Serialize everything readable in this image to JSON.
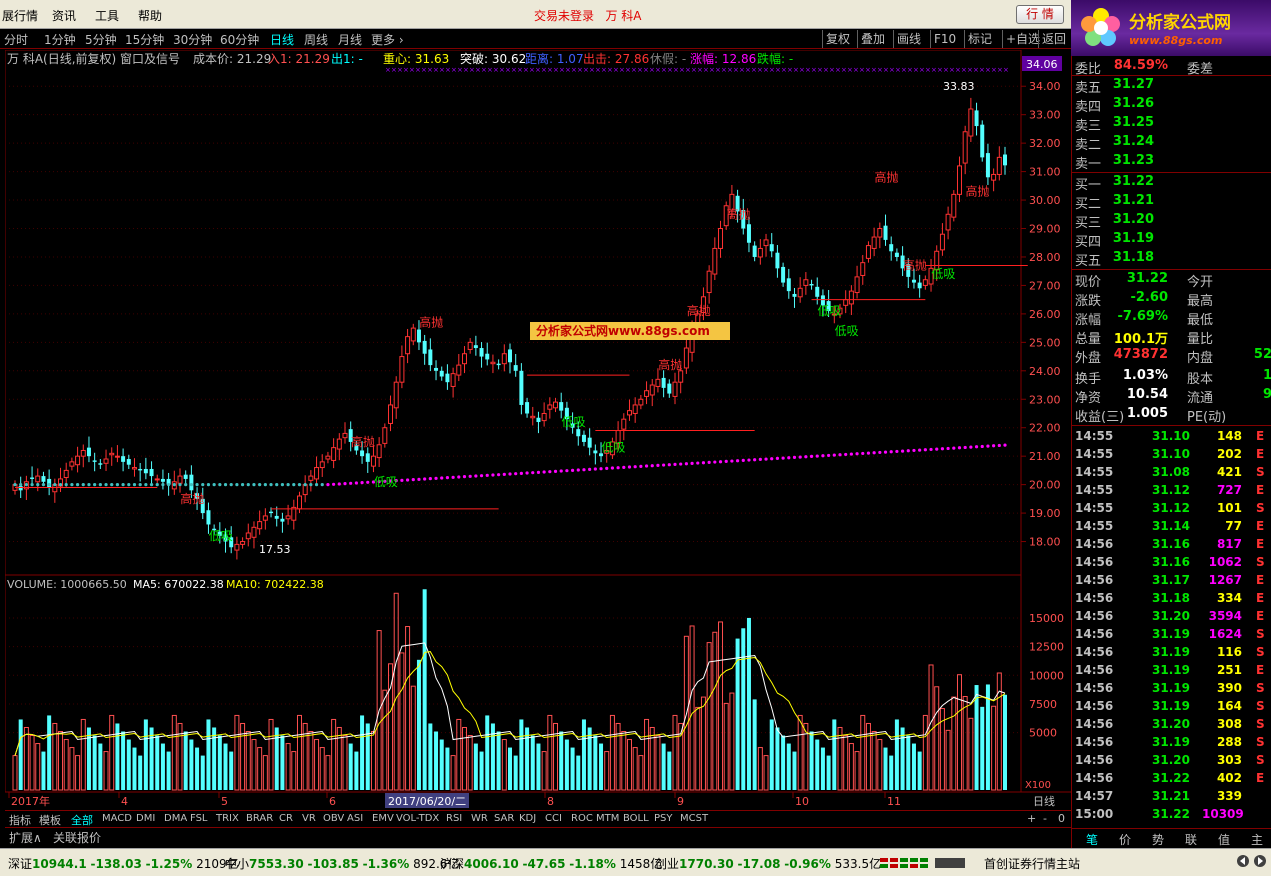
{
  "menu": [
    "展行情",
    "资讯",
    "工具",
    "帮助"
  ],
  "login_status": "交易未登录",
  "stock_name_top": "万 科A",
  "quote_button": "行 情",
  "logo": {
    "text": "分析家公式网",
    "url": "www.88gs.com"
  },
  "periods": [
    "分时",
    "1分钟",
    "5分钟",
    "15分钟",
    "30分钟",
    "60分钟",
    "日线",
    "周线",
    "月线",
    "更多 ›"
  ],
  "active_period": "日线",
  "right_buttons": [
    "复权",
    "叠加",
    "画线",
    "F10",
    "标记",
    "+自选",
    "返回"
  ],
  "info_line": {
    "title": "万 科A(日线,前复权) 窗口及信号",
    "cost": "成本价: 21.29",
    "in": "入1: 21.29",
    "out": "出1: -",
    "center": "重心: 31.63",
    "break": "突破: 30.62",
    "dist": "距离: 1.07",
    "exit": "出击: 27.86",
    "rest": "休假: -",
    "rise": "涨幅: 12.86",
    "fall": "跌幅: -"
  },
  "watermark": "分析家公式网www.88gs.com",
  "price_axis": {
    "labels": [
      "34.00",
      "33.00",
      "32.00",
      "31.00",
      "30.00",
      "29.00",
      "28.00",
      "27.00",
      "26.00",
      "25.00",
      "24.00",
      "23.00",
      "22.00",
      "21.00",
      "20.00",
      "19.00",
      "18.00"
    ],
    "current_tag": "34.06"
  },
  "volume_axis": {
    "labels": [
      "15000",
      "12500",
      "10000",
      "7500",
      "5000"
    ],
    "unit": "X100"
  },
  "volume_info": {
    "vol": "VOLUME: 1000665.50",
    "ma5": "MA5: 670022.38",
    "ma10": "MA10: 702422.38"
  },
  "date_axis": {
    "labels": [
      "2017年",
      "4",
      "5",
      "6",
      "8",
      "9",
      "10",
      "11"
    ],
    "cursor": "2017/06/20/二",
    "period": "日线"
  },
  "annotations": {
    "high": "33.83",
    "low": "17.53",
    "sell": "高抛",
    "buy": "低吸"
  },
  "chart_data": {
    "type": "candlestick",
    "ylim": [
      17,
      34.5
    ],
    "closes": [
      20.0,
      19.8,
      20.1,
      20.2,
      20.3,
      20.1,
      19.9,
      20.0,
      20.2,
      20.5,
      20.8,
      21.0,
      21.2,
      21.0,
      20.8,
      20.7,
      20.9,
      21.1,
      21.0,
      20.8,
      20.7,
      20.6,
      20.5,
      20.4,
      20.3,
      20.2,
      20.1,
      20.0,
      20.1,
      20.3,
      20.2,
      19.8,
      19.5,
      19.0,
      18.6,
      18.4,
      18.2,
      18.0,
      17.8,
      17.9,
      18.0,
      18.3,
      18.5,
      18.7,
      18.9,
      19.0,
      18.8,
      18.7,
      18.9,
      19.2,
      19.6,
      20.0,
      20.3,
      20.6,
      20.8,
      21.0,
      21.3,
      21.6,
      21.8,
      21.5,
      21.2,
      21.0,
      20.8,
      21.0,
      21.4,
      22.0,
      22.8,
      23.6,
      24.5,
      25.2,
      25.5,
      25.0,
      24.6,
      24.2,
      24.0,
      23.8,
      23.6,
      23.9,
      24.2,
      24.6,
      25.0,
      24.8,
      24.5,
      24.4,
      24.3,
      24.2,
      24.6,
      24.3,
      24.0,
      22.8,
      22.5,
      22.4,
      22.2,
      22.5,
      22.8,
      22.9,
      22.6,
      22.3,
      22.0,
      21.7,
      21.5,
      21.3,
      21.1,
      21.0,
      21.2,
      21.5,
      21.9,
      22.3,
      22.6,
      22.8,
      23.0,
      23.3,
      23.5,
      23.7,
      23.4,
      23.2,
      23.6,
      24.0,
      24.8,
      25.5,
      26.0,
      26.6,
      27.5,
      28.3,
      29.0,
      29.8,
      30.2,
      29.6,
      29.0,
      28.5,
      28.0,
      28.3,
      28.6,
      28.2,
      27.6,
      27.1,
      26.8,
      26.6,
      26.9,
      27.2,
      27.0,
      26.6,
      26.3,
      26.1,
      26.0,
      26.2,
      26.5,
      26.8,
      27.3,
      27.8,
      28.4,
      28.7,
      29.0,
      28.6,
      28.2,
      28.0,
      27.6,
      27.3,
      27.1,
      26.9,
      27.2,
      27.6,
      28.2,
      28.8,
      29.5,
      30.2,
      31.2,
      32.4,
      33.2,
      32.6,
      31.5,
      30.8,
      30.9,
      31.5,
      31.22
    ],
    "series": [
      {
        "name": "VOLUME",
        "values": [
          1000665.5
        ]
      },
      {
        "name": "MA5",
        "values": [
          670022.38
        ]
      },
      {
        "name": "MA10",
        "values": [
          702422.38
        ]
      }
    ]
  },
  "order_book": {
    "ratio_label": "委比",
    "ratio": "84.59%",
    "diff_label": "委差",
    "sells": [
      {
        "label": "卖五",
        "price": "31.27"
      },
      {
        "label": "卖四",
        "price": "31.26"
      },
      {
        "label": "卖三",
        "price": "31.25"
      },
      {
        "label": "卖二",
        "price": "31.24"
      },
      {
        "label": "卖一",
        "price": "31.23"
      }
    ],
    "buys": [
      {
        "label": "买一",
        "price": "31.22"
      },
      {
        "label": "买二",
        "price": "31.21"
      },
      {
        "label": "买三",
        "price": "31.20"
      },
      {
        "label": "买四",
        "price": "31.19"
      },
      {
        "label": "买五",
        "price": "31.18"
      }
    ]
  },
  "quote": [
    {
      "l": "现价",
      "v": "31.22",
      "vc": "green",
      "l2": "今开",
      "v2": ""
    },
    {
      "l": "涨跌",
      "v": "-2.60",
      "vc": "green",
      "l2": "最高",
      "v2": ""
    },
    {
      "l": "涨幅",
      "v": "-7.69%",
      "vc": "green",
      "l2": "最低",
      "v2": ""
    },
    {
      "l": "总量",
      "v": "100.1万",
      "vc": "yellow",
      "l2": "量比",
      "v2": ""
    },
    {
      "l": "外盘",
      "v": "473872",
      "vc": "red",
      "l2": "内盘",
      "v2": "52"
    },
    {
      "l": "换手",
      "v": "1.03%",
      "vc": "white",
      "l2": "股本",
      "v2": "1"
    },
    {
      "l": "净资",
      "v": "10.54",
      "vc": "white",
      "l2": "流通",
      "v2": "9"
    },
    {
      "l": "收益(三)",
      "v": "1.005",
      "vc": "white",
      "l2": "PE(动)",
      "v2": ""
    }
  ],
  "ticks": [
    {
      "t": "14:55",
      "p": "31.10",
      "v": "148",
      "d": "E",
      "pc": "green",
      "vc": "yellow"
    },
    {
      "t": "14:55",
      "p": "31.10",
      "v": "202",
      "d": "E",
      "pc": "green",
      "vc": "yellow"
    },
    {
      "t": "14:55",
      "p": "31.08",
      "v": "421",
      "d": "S",
      "pc": "green",
      "vc": "yellow"
    },
    {
      "t": "14:55",
      "p": "31.12",
      "v": "727",
      "d": "E",
      "pc": "green",
      "vc": "magenta"
    },
    {
      "t": "14:55",
      "p": "31.12",
      "v": "101",
      "d": "S",
      "pc": "green",
      "vc": "yellow"
    },
    {
      "t": "14:55",
      "p": "31.14",
      "v": "77",
      "d": "E",
      "pc": "green",
      "vc": "yellow"
    },
    {
      "t": "14:56",
      "p": "31.16",
      "v": "817",
      "d": "E",
      "pc": "green",
      "vc": "magenta"
    },
    {
      "t": "14:56",
      "p": "31.16",
      "v": "1062",
      "d": "S",
      "pc": "green",
      "vc": "magenta"
    },
    {
      "t": "14:56",
      "p": "31.17",
      "v": "1267",
      "d": "E",
      "pc": "green",
      "vc": "magenta"
    },
    {
      "t": "14:56",
      "p": "31.18",
      "v": "334",
      "d": "E",
      "pc": "green",
      "vc": "yellow"
    },
    {
      "t": "14:56",
      "p": "31.20",
      "v": "3594",
      "d": "E",
      "pc": "green",
      "vc": "magenta"
    },
    {
      "t": "14:56",
      "p": "31.19",
      "v": "1624",
      "d": "S",
      "pc": "green",
      "vc": "magenta"
    },
    {
      "t": "14:56",
      "p": "31.19",
      "v": "116",
      "d": "S",
      "pc": "green",
      "vc": "yellow"
    },
    {
      "t": "14:56",
      "p": "31.19",
      "v": "251",
      "d": "E",
      "pc": "green",
      "vc": "yellow"
    },
    {
      "t": "14:56",
      "p": "31.19",
      "v": "390",
      "d": "S",
      "pc": "green",
      "vc": "yellow"
    },
    {
      "t": "14:56",
      "p": "31.19",
      "v": "164",
      "d": "S",
      "pc": "green",
      "vc": "yellow"
    },
    {
      "t": "14:56",
      "p": "31.20",
      "v": "308",
      "d": "S",
      "pc": "green",
      "vc": "yellow"
    },
    {
      "t": "14:56",
      "p": "31.19",
      "v": "288",
      "d": "S",
      "pc": "green",
      "vc": "yellow"
    },
    {
      "t": "14:56",
      "p": "31.20",
      "v": "303",
      "d": "S",
      "pc": "green",
      "vc": "yellow"
    },
    {
      "t": "14:56",
      "p": "31.22",
      "v": "402",
      "d": "E",
      "pc": "green",
      "vc": "yellow"
    },
    {
      "t": "14:57",
      "p": "31.21",
      "v": "339",
      "d": "",
      "pc": "green",
      "vc": "yellow"
    },
    {
      "t": "15:00",
      "p": "31.22",
      "v": "10309",
      "d": "",
      "pc": "green",
      "vc": "magenta"
    }
  ],
  "right_tabs": [
    "笔",
    "价",
    "势",
    "联",
    "值",
    "主"
  ],
  "indicators": [
    "指标",
    "模板",
    "全部",
    "MACD",
    "DMI",
    "DMA",
    "FSL",
    "TRIX",
    "BRAR",
    "CR",
    "VR",
    "OBV",
    "ASI",
    "EMV",
    "VOL-TDX",
    "RSI",
    "WR",
    "SAR",
    "KDJ",
    "CCI",
    "ROC",
    "MTM",
    "BOLL",
    "PSY",
    "MCST"
  ],
  "indicator_selected": "全部",
  "extension": [
    "扩展∧",
    "关联报价"
  ],
  "status": {
    "sz": {
      "name": "深证",
      "val": "10944.1",
      "chg": "-138.03",
      "pct": "-1.25%",
      "amt": "2109亿"
    },
    "zx": {
      "name": "中小",
      "val": "7553.30",
      "chg": "-103.85",
      "pct": "-1.36%",
      "amt": "892.6亿"
    },
    "hs": {
      "name": "沪深",
      "val": "4006.10",
      "chg": "-47.65",
      "pct": "-1.18%",
      "amt": "1458亿"
    },
    "cy": {
      "name": "创业",
      "val": "1770.30",
      "chg": "-17.08",
      "pct": "-0.96%",
      "amt": "533.5亿"
    },
    "server": "首创证券行情主站"
  },
  "colors": {
    "up": "#ff3232",
    "down": "#54ffff",
    "ma5": "#ffffff",
    "ma10": "#ffff00",
    "dots": "#ff00ff",
    "grid": "#800000"
  }
}
